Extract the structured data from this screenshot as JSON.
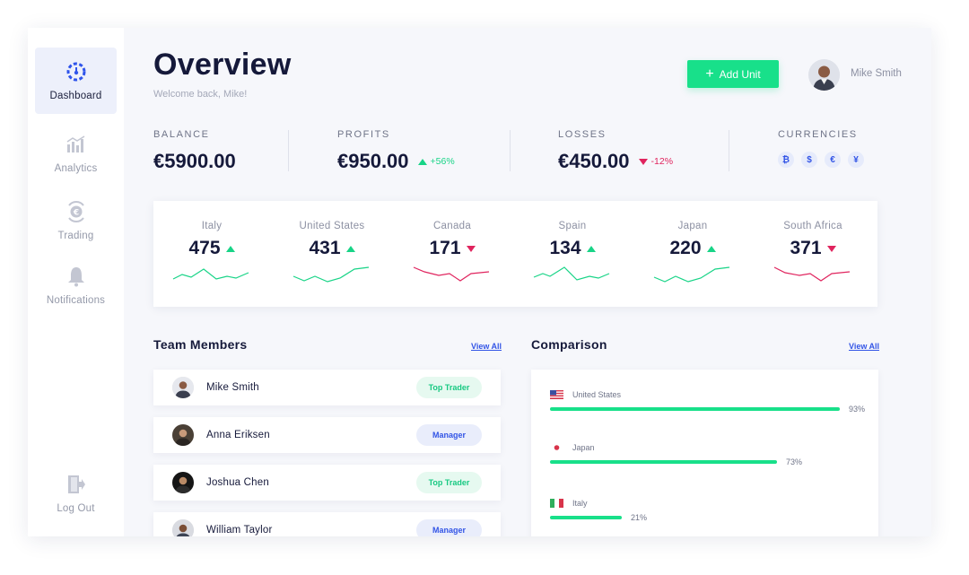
{
  "sidebar": {
    "items": [
      {
        "label": "Dashboard",
        "icon": "gauge-icon",
        "active": true
      },
      {
        "label": "Analytics",
        "icon": "bar-chart-icon"
      },
      {
        "label": "Trading",
        "icon": "euro-exchange-icon"
      },
      {
        "label": "Notifications",
        "icon": "bell-icon"
      }
    ],
    "logout_label": "Log Out"
  },
  "header": {
    "title": "Overview",
    "welcome": "Welcome back, Mike!",
    "add_button": "Add Unit",
    "user_name": "Mike Smith"
  },
  "stats": {
    "balance": {
      "label": "BALANCE",
      "value": "€5900.00"
    },
    "profits": {
      "label": "PROFITS",
      "value": "€950.00",
      "delta": "+56%"
    },
    "losses": {
      "label": "LOSSES",
      "value": "€450.00",
      "delta": "-12%"
    },
    "currencies": {
      "label": "CURRENCIES",
      "symbols": [
        "₿",
        "$",
        "€",
        "¥"
      ]
    }
  },
  "countries": [
    {
      "name": "Italy",
      "value": "475",
      "trend": "up"
    },
    {
      "name": "United States",
      "value": "431",
      "trend": "up"
    },
    {
      "name": "Canada",
      "value": "171",
      "trend": "down"
    },
    {
      "name": "Spain",
      "value": "134",
      "trend": "up"
    },
    {
      "name": "Japan",
      "value": "220",
      "trend": "up"
    },
    {
      "name": "South Africa",
      "value": "371",
      "trend": "down"
    }
  ],
  "team": {
    "title": "Team Members",
    "view_all": "View All",
    "members": [
      {
        "name": "Mike Smith",
        "role": "Top Trader"
      },
      {
        "name": "Anna Eriksen",
        "role": "Manager"
      },
      {
        "name": "Joshua Chen",
        "role": "Top Trader"
      },
      {
        "name": "William Taylor",
        "role": "Manager"
      }
    ]
  },
  "comparison": {
    "title": "Comparison",
    "view_all": "View All",
    "rows": [
      {
        "country": "United States",
        "pct_label": "93%",
        "pct": 0.93
      },
      {
        "country": "Japan",
        "pct_label": "73%",
        "pct": 0.73
      },
      {
        "country": "Italy",
        "pct_label": "21%",
        "pct": 0.21
      }
    ]
  },
  "colors": {
    "accent": "#18e08a",
    "primary": "#3355e6",
    "negative": "#e0245e"
  }
}
